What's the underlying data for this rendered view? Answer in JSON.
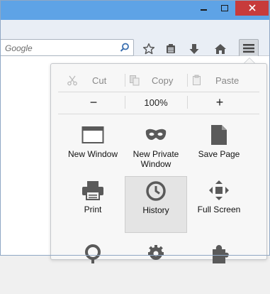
{
  "search": {
    "placeholder": "Google"
  },
  "edit": {
    "cut": "Cut",
    "copy": "Copy",
    "paste": "Paste"
  },
  "zoom": {
    "minus": "−",
    "level": "100%",
    "plus": "+"
  },
  "menu_items": [
    {
      "label": "New Window",
      "icon": "new-window-icon"
    },
    {
      "label": "New Private Window",
      "icon": "private-mask-icon"
    },
    {
      "label": "Save Page",
      "icon": "save-page-icon"
    },
    {
      "label": "Print",
      "icon": "printer-icon"
    },
    {
      "label": "History",
      "icon": "clock-icon"
    },
    {
      "label": "Full Screen",
      "icon": "fullscreen-icon"
    },
    {
      "label": "",
      "icon": "search-icon"
    },
    {
      "label": "",
      "icon": "gear-icon"
    },
    {
      "label": "",
      "icon": "puzzle-icon"
    }
  ],
  "colors": {
    "titlebar": "#5ea3e6",
    "close": "#c73b3b",
    "icon": "#5a5a5a",
    "active_item": "#e4e4e4"
  }
}
